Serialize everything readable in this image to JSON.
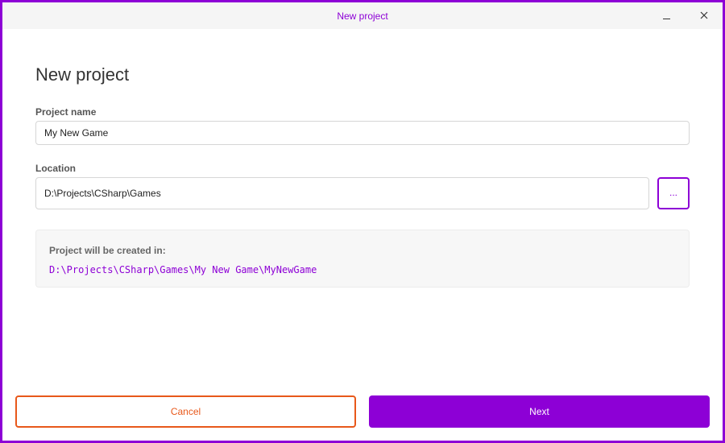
{
  "window": {
    "title": "New project",
    "accent_color": "#8d00d6"
  },
  "page": {
    "heading": "New project"
  },
  "project_name": {
    "label": "Project name",
    "value": "My New Game"
  },
  "location": {
    "label": "Location",
    "value": "D:\\Projects\\CSharp\\Games",
    "browse_label": "..."
  },
  "summary": {
    "caption": "Project will be created in:",
    "path": "D:\\Projects\\CSharp\\Games\\My New Game\\MyNewGame"
  },
  "footer": {
    "cancel_label": "Cancel",
    "cancel_color": "#e8581a",
    "next_label": "Next"
  }
}
